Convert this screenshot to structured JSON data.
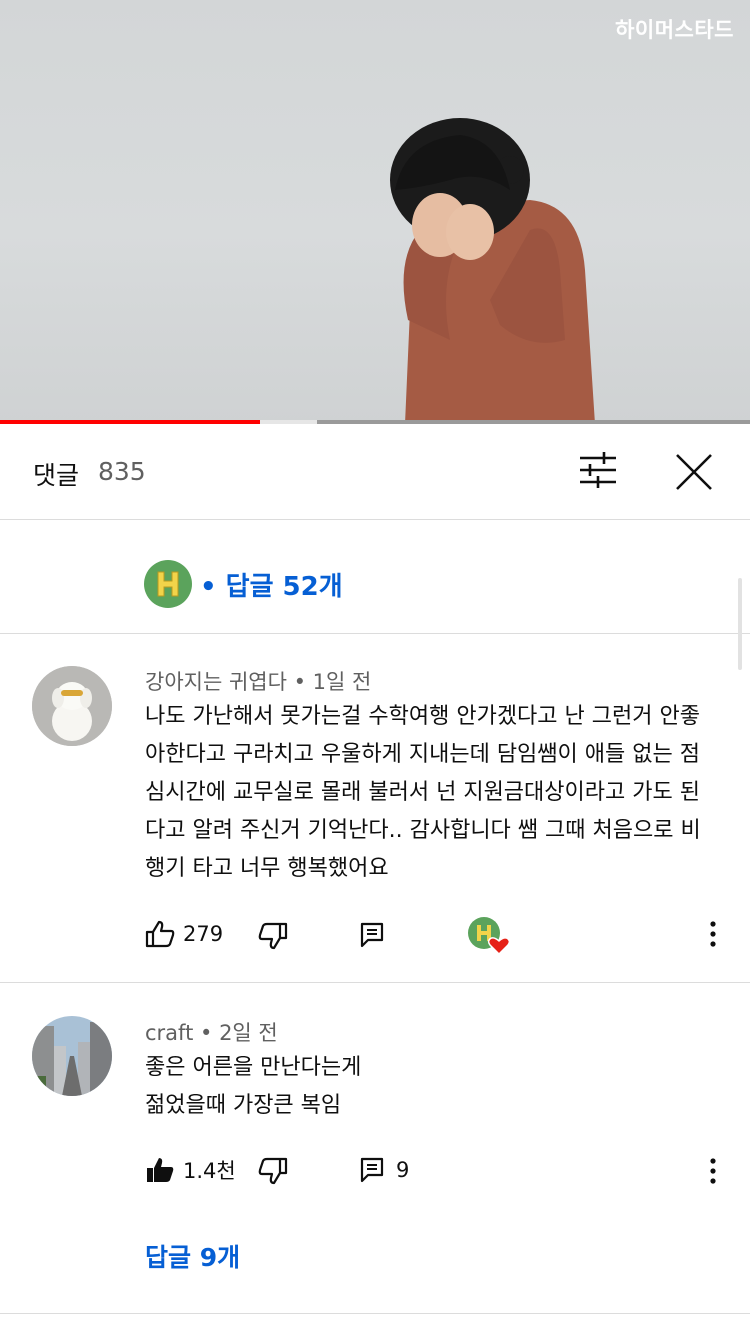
{
  "video": {
    "watermark": "하이머스타드",
    "progress_played": 0.347,
    "progress_buffered": 0.422
  },
  "header": {
    "title": "댓글",
    "count": "835"
  },
  "creator_reply": {
    "text": "• 답글 52개",
    "avatar_color": "#5ba35c"
  },
  "comments": [
    {
      "author": "강아지는 귀엽다",
      "time": "1일 전",
      "lines": [
        "나도 가난해서 못가는걸 수학여행 안가겠다고 난 그런거 안좋",
        "아한다고 구라치고 우울하게 지내는데 담임쌤이 애들 없는 점",
        "심시간에 교무실로 몰래 불러서 넌 지원금대상이라고 가도 된",
        "다고 알려 주신거 기억난다.. 감사합니다 쌤  그때 처음으로 비",
        "행기 타고 너무 행복했어요"
      ],
      "likes": "279",
      "liked": false,
      "replies": "",
      "hearted_by_creator": true
    },
    {
      "author": "craft",
      "time": "2일 전",
      "lines": [
        "좋은 어른을 만난다는게",
        "젊었을때  가장큰 복임"
      ],
      "likes": "1.4천",
      "liked": true,
      "replies": "9",
      "hearted_by_creator": false
    }
  ],
  "more_replies": "답글 9개",
  "colors": {
    "accent_blue": "#065fd4",
    "progress_red": "#ff0000",
    "heart_red": "#e62117",
    "meta_gray": "#606060"
  }
}
